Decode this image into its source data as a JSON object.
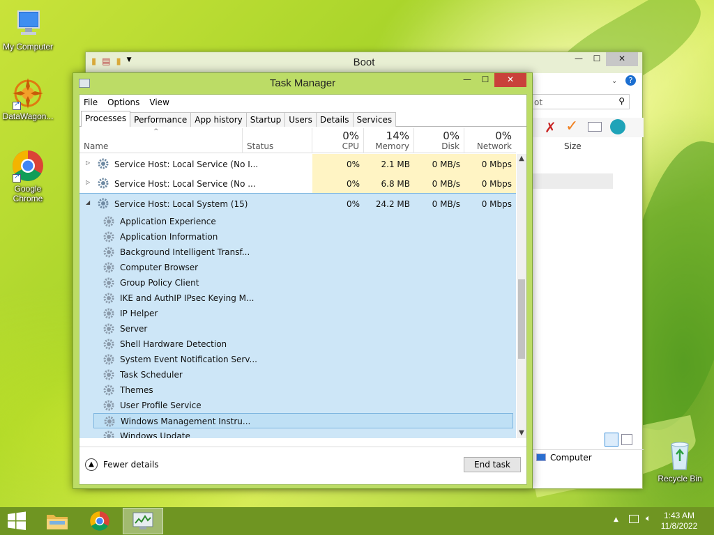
{
  "desktop": {
    "icons": [
      {
        "label": "My Computer"
      },
      {
        "label": "DataWagon..."
      },
      {
        "label": "Google Chrome"
      },
      {
        "label": "Recycle Bin"
      }
    ]
  },
  "explorer": {
    "title": "Boot",
    "search_partial": "ot",
    "size_header": "Size",
    "status_location": "Computer"
  },
  "taskmanager": {
    "title": "Task Manager",
    "menu": [
      "File",
      "Options",
      "View"
    ],
    "tabs": [
      "Processes",
      "Performance",
      "App history",
      "Startup",
      "Users",
      "Details",
      "Services"
    ],
    "active_tab": "Processes",
    "columns": {
      "name": "Name",
      "status": "Status",
      "cpu": {
        "pct": "0%",
        "label": "CPU"
      },
      "memory": {
        "pct": "14%",
        "label": "Memory"
      },
      "disk": {
        "pct": "0%",
        "label": "Disk"
      },
      "network": {
        "pct": "0%",
        "label": "Network"
      }
    },
    "processes": [
      {
        "name": "Service Host: Local Service (No I...",
        "cpu": "0%",
        "memory": "2.1 MB",
        "disk": "0 MB/s",
        "network": "0 Mbps"
      },
      {
        "name": "Service Host: Local Service (No ...",
        "cpu": "0%",
        "memory": "6.8 MB",
        "disk": "0 MB/s",
        "network": "0 Mbps"
      },
      {
        "name": "Service Host: Local System (15)",
        "cpu": "0%",
        "memory": "24.2 MB",
        "disk": "0 MB/s",
        "network": "0 Mbps"
      }
    ],
    "services": [
      "Application Experience",
      "Application Information",
      "Background Intelligent Transf...",
      "Computer Browser",
      "Group Policy Client",
      "IKE and AuthIP IPsec Keying M...",
      "IP Helper",
      "Server",
      "Shell Hardware Detection",
      "System Event Notification Serv...",
      "Task Scheduler",
      "Themes",
      "User Profile Service",
      "Windows Management Instru...",
      "Windows Update"
    ],
    "fewer_details": "Fewer details",
    "end_task": "End task"
  },
  "taskbar": {
    "time": "1:43 AM",
    "date": "11/8/2022"
  },
  "colors": {
    "tm_frame": "#bcdc66",
    "selection": "#cde6f7",
    "heat": "#fff4c4",
    "taskbar": "#6f9522",
    "close_red": "#c9413a"
  }
}
